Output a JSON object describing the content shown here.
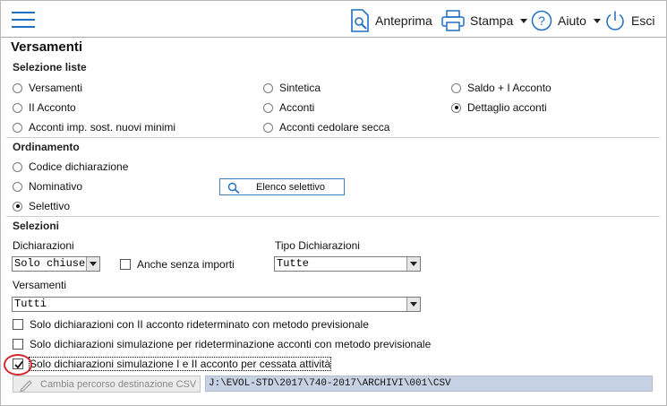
{
  "toolbar": {
    "preview_label": "Anteprima",
    "print_label": "Stampa",
    "help_label": "Aiuto",
    "exit_label": "Esci"
  },
  "page": {
    "title": "Versamenti"
  },
  "selezione_liste": {
    "heading": "Selezione liste",
    "options": [
      {
        "label": "Versamenti",
        "selected": false
      },
      {
        "label": "Sintetica",
        "selected": false
      },
      {
        "label": "Saldo + I Acconto",
        "selected": false
      },
      {
        "label": "II Acconto",
        "selected": false
      },
      {
        "label": "Acconti",
        "selected": false
      },
      {
        "label": "Dettaglio acconti",
        "selected": true
      },
      {
        "label": "Acconti imp. sost. nuovi minimi",
        "selected": false
      },
      {
        "label": "Acconti cedolare secca",
        "selected": false
      }
    ]
  },
  "ordinamento": {
    "heading": "Ordinamento",
    "options": [
      {
        "label": "Codice dichiarazione",
        "selected": false
      },
      {
        "label": "Nominativo",
        "selected": false
      },
      {
        "label": "Selettivo",
        "selected": true
      }
    ],
    "elenco_button": "Elenco selettivo"
  },
  "selezioni": {
    "heading": "Selezioni",
    "dichiarazioni_label": "Dichiarazioni",
    "dichiarazioni_value": "Solo chiuse",
    "anche_senza_importi_label": "Anche senza importi",
    "anche_senza_importi_checked": false,
    "tipo_label": "Tipo Dichiarazioni",
    "tipo_value": "Tutte",
    "versamenti_label": "Versamenti",
    "versamenti_value": "Tutti",
    "checks": [
      {
        "label": "Solo dichiarazioni con II acconto rideterminato con metodo previsionale",
        "checked": false
      },
      {
        "label": "Solo dichiarazioni simulazione per rideterminazione acconti con metodo previsionale",
        "checked": false
      },
      {
        "label": "Solo dichiarazioni simulazione I e II acconto per cessata attività",
        "checked": true
      }
    ],
    "cambia_button": "Cambia percorso destinazione CSV",
    "path_value": "J:\\EVOL-STD\\2017\\740-2017\\ARCHIVI\\001\\CSV"
  },
  "colors": {
    "accent": "#1f6fc2",
    "highlight_ring": "#d42a2a",
    "path_field_bg": "#c7d3e4"
  }
}
